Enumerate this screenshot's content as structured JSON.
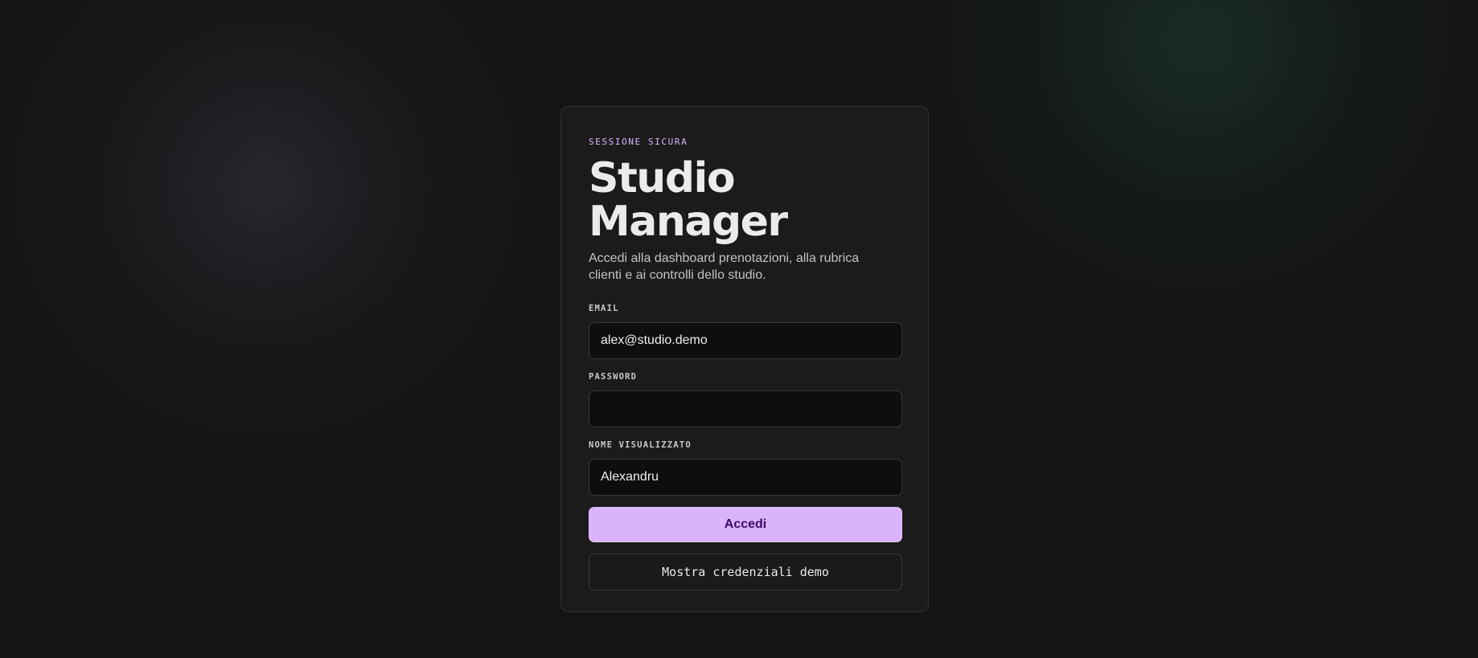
{
  "login": {
    "eyebrow": "SESSIONE SICURA",
    "title": "Studio Manager",
    "subtitle": "Accedi alla dashboard prenotazioni, alla rubrica clienti e ai controlli dello studio.",
    "fields": {
      "email": {
        "label": "EMAIL",
        "value": "alex@studio.demo"
      },
      "password": {
        "label": "PASSWORD",
        "value": ""
      },
      "display_name": {
        "label": "NOME VISUALIZZATO",
        "value": "Alexandru"
      }
    },
    "submit_label": "Accedi",
    "demo_credentials_label": "Mostra credenziali demo"
  },
  "colors": {
    "background": "#141414",
    "card": "#1c1b1c",
    "accent": "#dbb3fd",
    "accent_text": "#3a0a64",
    "eyebrow": "#d9b5ff"
  }
}
